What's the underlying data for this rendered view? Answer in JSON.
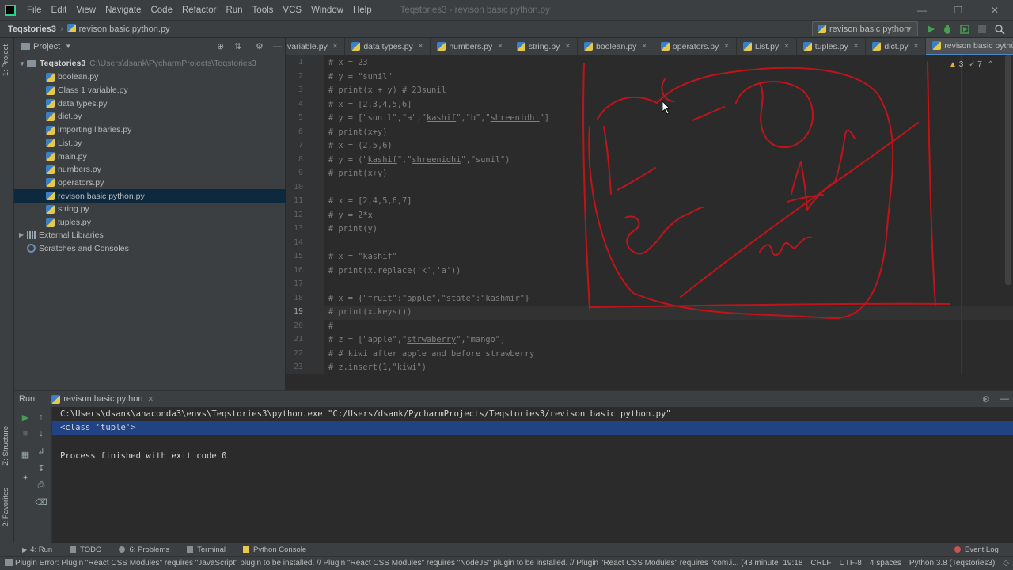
{
  "menubar": {
    "items": [
      "File",
      "Edit",
      "View",
      "Navigate",
      "Code",
      "Refactor",
      "Run",
      "Tools",
      "VCS",
      "Window",
      "Help"
    ],
    "window_title": "Teqstories3 - revison basic python.py"
  },
  "navbar": {
    "project": "Teqstories3",
    "file": "revison basic python.py",
    "run_config": "revison basic python"
  },
  "left_strip": {
    "project_tab": "1: Project",
    "structure_tab": "Z: Structure",
    "favorites_tab": "2: Favorites"
  },
  "project_panel": {
    "title": "Project",
    "root": {
      "name": "Teqstories3",
      "path": "C:\\Users\\dsank\\PycharmProjects\\Teqstories3"
    },
    "files": [
      "boolean.py",
      "Class 1 variable.py",
      "data types.py",
      "dict.py",
      "importing libaries.py",
      "List.py",
      "main.py",
      "numbers.py",
      "operators.py",
      "revison basic python.py",
      "string.py",
      "tuples.py"
    ],
    "selected_file": "revison basic python.py",
    "external_libraries": "External Libraries",
    "scratches": "Scratches and Consoles"
  },
  "tabs": [
    "variable.py",
    "data types.py",
    "numbers.py",
    "string.py",
    "boolean.py",
    "operators.py",
    "List.py",
    "tuples.py",
    "dict.py",
    "revison basic python.py"
  ],
  "active_tab": "revison basic python.py",
  "editor": {
    "inspection_warnings": "3",
    "inspection_weak": "7",
    "current_line": 19,
    "lines": [
      {
        "n": "1",
        "segs": [
          "# x = 23"
        ]
      },
      {
        "n": "2",
        "segs": [
          "# y = \"sunil\""
        ]
      },
      {
        "n": "3",
        "segs": [
          "# print(x + y) # 23sunil"
        ]
      },
      {
        "n": "4",
        "segs": [
          "# x = [2,3,4,5,6]"
        ]
      },
      {
        "n": "5",
        "segs": [
          "# y = [\"sunil\",\"a\",\"",
          "kashif",
          "\",\"b\",\"",
          "shreenidhi",
          "\"]"
        ]
      },
      {
        "n": "6",
        "segs": [
          "# print(x+y)"
        ]
      },
      {
        "n": "7",
        "segs": [
          "# x = (2,5,6)"
        ]
      },
      {
        "n": "8",
        "segs": [
          "# y = (\"",
          "kashif",
          "\",\"",
          "shreenidhi",
          "\",\"sunil\")"
        ]
      },
      {
        "n": "9",
        "segs": [
          "# print(x+y)"
        ]
      },
      {
        "n": "10",
        "segs": [
          ""
        ]
      },
      {
        "n": "11",
        "segs": [
          "# x = [2,4,5,6,7]"
        ]
      },
      {
        "n": "12",
        "segs": [
          "# y = 2*x"
        ]
      },
      {
        "n": "13",
        "segs": [
          "# print(y)"
        ]
      },
      {
        "n": "14",
        "segs": [
          ""
        ]
      },
      {
        "n": "15",
        "segs": [
          "# x = \"",
          "kashif",
          "\""
        ]
      },
      {
        "n": "16",
        "segs": [
          "# print(x.replace('k','a'))"
        ]
      },
      {
        "n": "17",
        "segs": [
          ""
        ]
      },
      {
        "n": "18",
        "segs": [
          "# x = {\"fruit\":\"apple\",\"state\":\"kashmir\"}"
        ]
      },
      {
        "n": "19",
        "segs": [
          "# print(x.keys())"
        ]
      },
      {
        "n": "20",
        "segs": [
          "#"
        ]
      },
      {
        "n": "21",
        "segs": [
          "# z = [\"apple\",\"",
          "strwaberry",
          "\",\"mango\"]"
        ]
      },
      {
        "n": "22",
        "segs": [
          "# # kiwi after apple and before strawberry"
        ]
      },
      {
        "n": "23",
        "segs": [
          "# z.insert(1,\"kiwi\")"
        ]
      }
    ]
  },
  "run_panel": {
    "label": "Run:",
    "config": "revison basic python",
    "console": [
      "C:\\Users\\dsank\\anaconda3\\envs\\Teqstories3\\python.exe \"C:/Users/dsank/PycharmProjects/Teqstories3/revison basic python.py\"",
      "<class 'tuple'>",
      "",
      "Process finished with exit code 0"
    ]
  },
  "bottom_tabs": [
    "4: Run",
    "TODO",
    "6: Problems",
    "Terminal",
    "Python Console"
  ],
  "event_log": "Event Log",
  "statusbar": {
    "message": "Plugin Error: Plugin \"React CSS Modules\" requires \"JavaScript\" plugin to be installed. // Plugin \"React CSS Modules\" requires \"NodeJS\" plugin to be installed. // Plugin \"React CSS Modules\" requires \"com.i... (43 minute",
    "position": "19:18",
    "line_sep": "CRLF",
    "encoding": "UTF-8",
    "indent": "4 spaces",
    "interpreter": "Python 3.8 (Teqstories3)"
  },
  "colors": {
    "accent": "#4a88c7",
    "selection": "#214283",
    "tree_selection": "#0d293e",
    "annotation": "#c0141a"
  }
}
